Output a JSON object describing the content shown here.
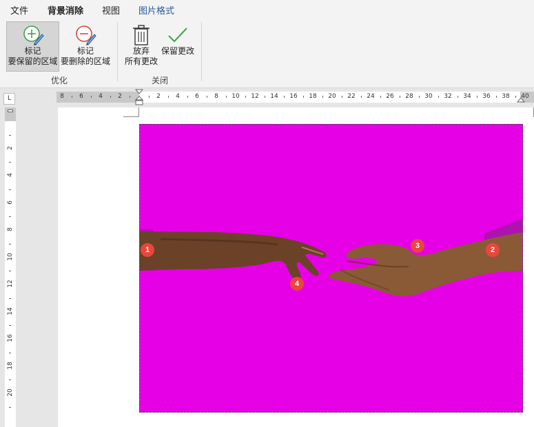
{
  "tabs": [
    {
      "label": "文件"
    },
    {
      "label": "背景消除"
    },
    {
      "label": "视图"
    },
    {
      "label": "图片格式"
    }
  ],
  "ribbon": {
    "mark_keep": {
      "line1": "标记",
      "line2": "要保留的区域"
    },
    "mark_remove": {
      "line1": "标记",
      "line2": "要删除的区域"
    },
    "discard": {
      "line1": "放弃",
      "line2": "所有更改"
    },
    "keep_changes": {
      "label": "保留更改"
    },
    "group_refine": "优化",
    "group_close": "关闭"
  },
  "ruler": {
    "corner": "L",
    "h_left_numbers": [
      "8",
      "6",
      "4",
      "2"
    ],
    "h_right_numbers": [
      "2",
      "4",
      "6",
      "8",
      "10",
      "12",
      "14",
      "16",
      "18",
      "20",
      "22",
      "24",
      "26",
      "28",
      "30",
      "32",
      "34",
      "36",
      "38",
      "40"
    ],
    "v_numbers": [
      "2",
      "4",
      "6",
      "8",
      "10",
      "12",
      "14",
      "16",
      "18",
      "20"
    ]
  },
  "markers": [
    "1",
    "2",
    "3",
    "4"
  ],
  "colors": {
    "removed_area": "#e600e6",
    "marker": "#e8473c",
    "accent": "#2b579a"
  }
}
